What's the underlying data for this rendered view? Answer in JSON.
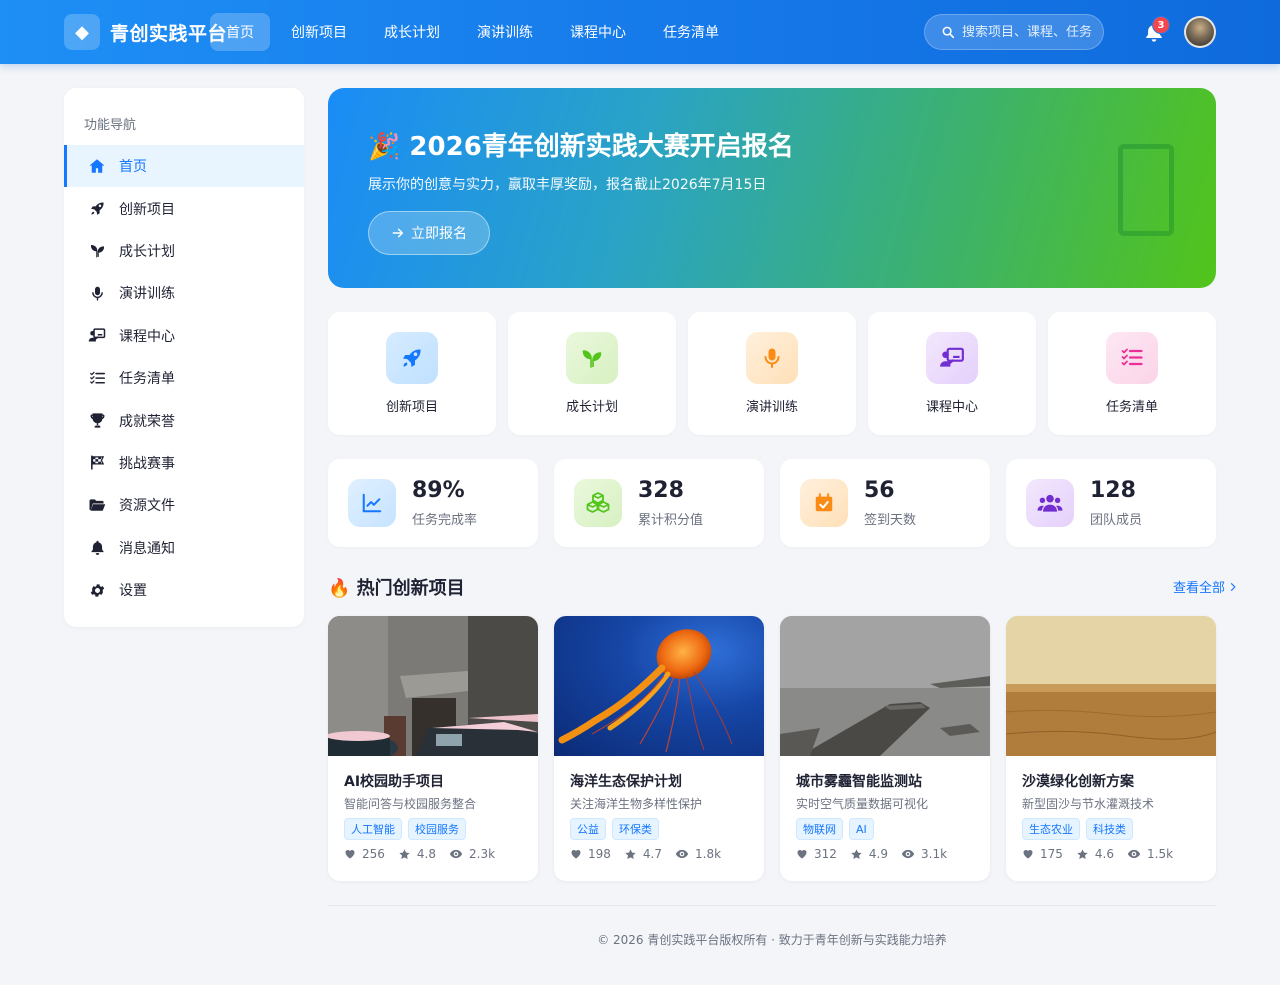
{
  "brand": {
    "name": "青创实践平台"
  },
  "nav": [
    {
      "label": "首页",
      "active": true
    },
    {
      "label": "创新项目"
    },
    {
      "label": "成长计划"
    },
    {
      "label": "演讲训练"
    },
    {
      "label": "课程中心"
    },
    {
      "label": "任务清单"
    }
  ],
  "search": {
    "placeholder": "搜索项目、课程、任务..."
  },
  "notifications": {
    "count": "3"
  },
  "sidebar": {
    "title": "功能导航",
    "items": [
      {
        "label": "首页",
        "icon": "home-icon",
        "active": true
      },
      {
        "label": "创新项目",
        "icon": "rocket-icon"
      },
      {
        "label": "成长计划",
        "icon": "seedling-icon"
      },
      {
        "label": "演讲训练",
        "icon": "microphone-icon"
      },
      {
        "label": "课程中心",
        "icon": "teacher-board-icon"
      },
      {
        "label": "任务清单",
        "icon": "checklist-icon"
      },
      {
        "label": "成就荣誉",
        "icon": "trophy-icon"
      },
      {
        "label": "挑战赛事",
        "icon": "flag-checkered-icon"
      },
      {
        "label": "资源文件",
        "icon": "folder-open-icon"
      },
      {
        "label": "消息通知",
        "icon": "bell-icon"
      },
      {
        "label": "设置",
        "icon": "gear-icon"
      }
    ]
  },
  "banner": {
    "title": "🎉 2026青年创新实践大赛开启报名",
    "subtitle": "展示你的创意与实力，赢取丰厚奖励，报名截止2026年7月15日",
    "button_label": "立即报名"
  },
  "quick_links": [
    {
      "label": "创新项目",
      "icon": "rocket-icon",
      "color": "#1677ff",
      "bg": "#e0f0ff"
    },
    {
      "label": "成长计划",
      "icon": "seedling-icon",
      "color": "#52c41a",
      "bg": "#eaf8dd"
    },
    {
      "label": "演讲训练",
      "icon": "microphone-icon",
      "color": "#fa8c16",
      "bg": "#fff0dc"
    },
    {
      "label": "课程中心",
      "icon": "teacher-board-icon",
      "color": "#722ed1",
      "bg": "#f0e4fc"
    },
    {
      "label": "任务清单",
      "icon": "checklist-icon",
      "color": "#eb2f96",
      "bg": "#fde4f1"
    }
  ],
  "stats": [
    {
      "value": "89%",
      "label": "任务完成率",
      "icon": "chart-line-icon",
      "color": "#1677ff",
      "bg": "#e0f0ff"
    },
    {
      "value": "328",
      "label": "累计积分值",
      "icon": "cubes-icon",
      "color": "#52c41a",
      "bg": "#eaf8dd"
    },
    {
      "value": "56",
      "label": "签到天数",
      "icon": "calendar-check-icon",
      "color": "#fa8c16",
      "bg": "#fff0dc"
    },
    {
      "value": "128",
      "label": "团队成员",
      "icon": "users-icon",
      "color": "#722ed1",
      "bg": "#f0e4fc"
    }
  ],
  "projects_section": {
    "title": "🔥 热门创新项目",
    "more_label": "查看全部"
  },
  "projects": [
    {
      "title": "AI校园助手项目",
      "desc": "智能问答与校园服务整合",
      "tags": [
        "人工智能",
        "校园服务"
      ],
      "likes": "256",
      "rating": "4.8",
      "views": "2.3k"
    },
    {
      "title": "海洋生态保护计划",
      "desc": "关注海洋生物多样性保护",
      "tags": [
        "公益",
        "环保类"
      ],
      "likes": "198",
      "rating": "4.7",
      "views": "1.8k"
    },
    {
      "title": "城市雾霾智能监测站",
      "desc": "实时空气质量数据可视化",
      "tags": [
        "物联网",
        "AI"
      ],
      "likes": "312",
      "rating": "4.9",
      "views": "3.1k"
    },
    {
      "title": "沙漠绿化创新方案",
      "desc": "新型固沙与节水灌溉技术",
      "tags": [
        "生态农业",
        "科技类"
      ],
      "likes": "175",
      "rating": "4.6",
      "views": "1.5k"
    }
  ],
  "footer": {
    "text": "© 2026 青创实践平台版权所有 · 致力于青年创新与实践能力培养"
  }
}
